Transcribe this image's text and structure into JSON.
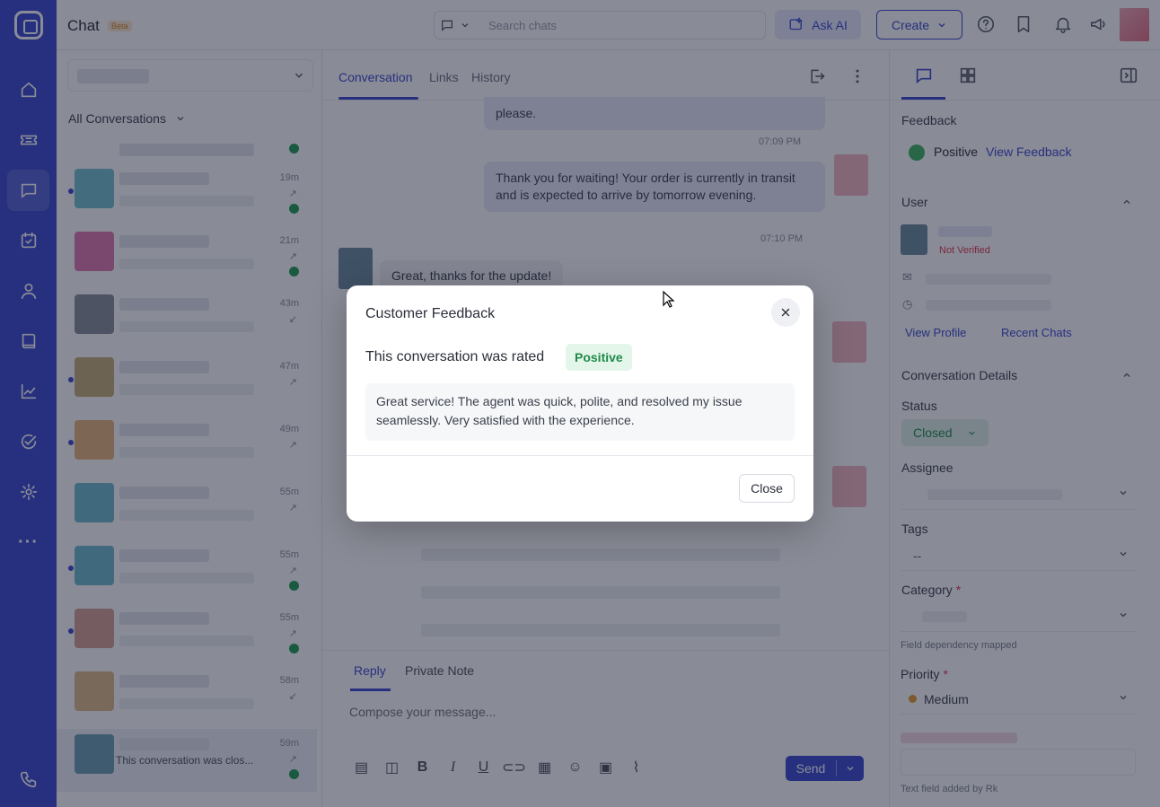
{
  "header": {
    "title": "Chat",
    "beta": "Beta",
    "search_placeholder": "Search chats",
    "ask_ai": "Ask AI",
    "create": "Create"
  },
  "list": {
    "filter_label": "All Conversations",
    "rows": [
      {
        "time": "",
        "dir": "",
        "unread": false,
        "done": true
      },
      {
        "time": "19m",
        "dir": "↗",
        "unread": true,
        "done": true
      },
      {
        "time": "21m",
        "dir": "↗",
        "unread": false,
        "done": true
      },
      {
        "time": "43m",
        "dir": "↙",
        "unread": false,
        "done": false
      },
      {
        "time": "47m",
        "dir": "↗",
        "unread": true,
        "done": false
      },
      {
        "time": "49m",
        "dir": "↗",
        "unread": true,
        "done": false
      },
      {
        "time": "55m",
        "dir": "↗",
        "unread": false,
        "done": false
      },
      {
        "time": "55m",
        "dir": "↗",
        "unread": true,
        "done": true
      },
      {
        "time": "55m",
        "dir": "↗",
        "unread": true,
        "done": true
      },
      {
        "time": "58m",
        "dir": "↙",
        "unread": false,
        "done": false
      },
      {
        "time": "59m",
        "dir": "↗",
        "unread": false,
        "done": true,
        "preview": "This conversation was clos..."
      }
    ]
  },
  "center": {
    "tabs": [
      "Conversation",
      "Links",
      "History"
    ],
    "messages": {
      "m1_text": "please.",
      "m1_time": "07:09 PM",
      "m2_text": "Thank you for waiting! Your order is currently in transit and is expected to arrive by tomorrow evening.",
      "m2_time": "07:10 PM",
      "m3_text": "Great, thanks for the update!"
    },
    "reply_tab": "Reply",
    "note_tab": "Private Note",
    "composer_placeholder": "Compose your message...",
    "send": "Send"
  },
  "right": {
    "feedback_label": "Feedback",
    "feedback_value": "Positive",
    "view_feedback": "View Feedback",
    "user_label": "User",
    "not_verified": "Not Verified",
    "view_profile": "View Profile",
    "recent_chats": "Recent Chats",
    "conv_details": "Conversation Details",
    "status_label": "Status",
    "status_value": "Closed",
    "assignee_label": "Assignee",
    "tags_label": "Tags",
    "tags_value": "--",
    "category_label": "Category",
    "category_hint": "Field dependency mapped",
    "priority_label": "Priority",
    "priority_value": "Medium",
    "text_field_hint": "Text field added by Rk"
  },
  "modal": {
    "title": "Customer Feedback",
    "rated_text": "This conversation was rated",
    "rating": "Positive",
    "comment": "Great service! The agent was quick, polite, and resolved my issue seamlessly. Very satisfied with the experience.",
    "close_button": "Close",
    "close_icon": "close-icon"
  },
  "colors": {
    "brand": "#3b49d1",
    "positive": "#1e8a4a",
    "positive_bg": "#e4f6ea"
  }
}
